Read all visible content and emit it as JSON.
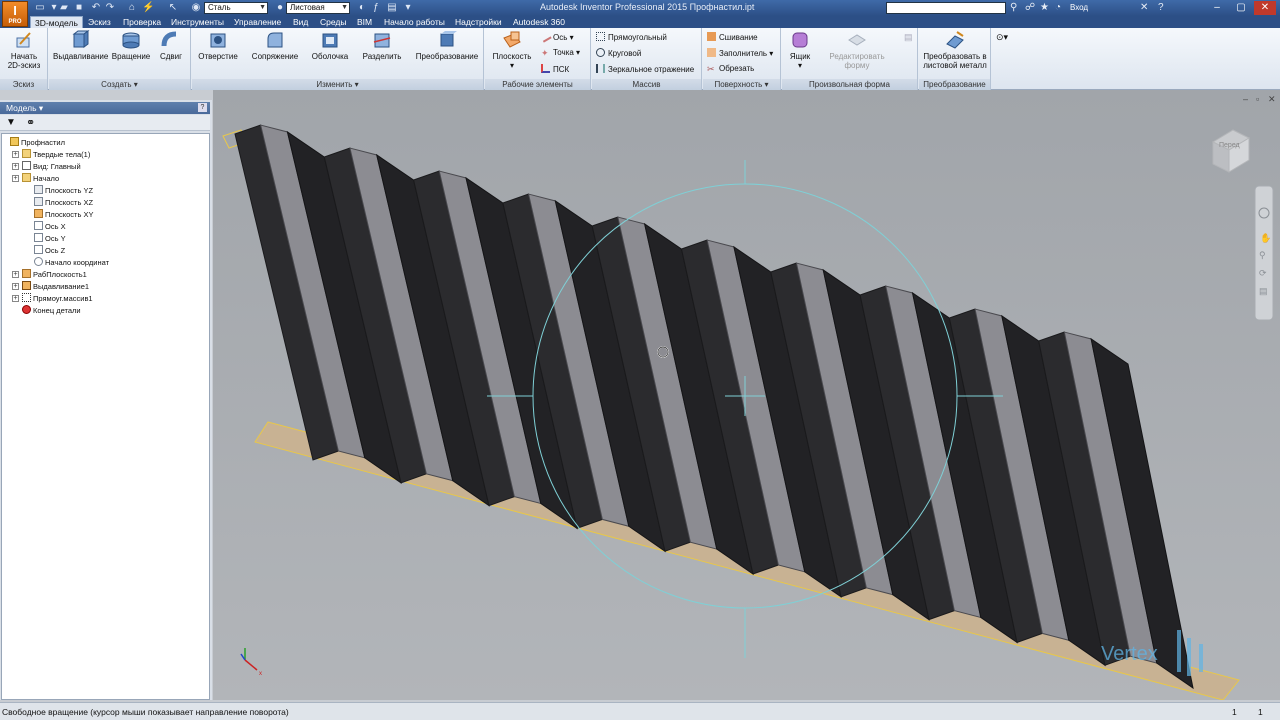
{
  "titlebar": {
    "logo": "I",
    "logo_sub": "PRO",
    "material_combo": "Сталь",
    "style_combo": "Листовая",
    "window_title": "Autodesk Inventor Professional 2015    Профнастил.ipt",
    "search_placeholder": "",
    "signin_label": "Вход"
  },
  "ribbon_tabs": [
    {
      "label": "3D-модель",
      "active": true
    },
    {
      "label": "Эскиз"
    },
    {
      "label": "Проверка"
    },
    {
      "label": "Инструменты"
    },
    {
      "label": "Управление"
    },
    {
      "label": "Вид"
    },
    {
      "label": "Среды"
    },
    {
      "label": "BIM"
    },
    {
      "label": "Начало работы"
    },
    {
      "label": "Надстройки"
    },
    {
      "label": "Autodesk 360"
    }
  ],
  "ribbon": {
    "sketch": {
      "label": "Эскиз",
      "start_line1": "Начать",
      "start_line2": "2D-эскиз"
    },
    "create": {
      "label": "Создать",
      "extrude": "Выдавливание",
      "revolve": "Вращение",
      "sweep": "Сдвиг"
    },
    "modify": {
      "label": "Изменить",
      "hole": "Отверстие",
      "fillet": "Сопряжение",
      "shell": "Оболочка",
      "split": "Разделить",
      "convert": "Преобразование"
    },
    "work": {
      "label": "Рабочие элементы",
      "plane": "Плоскость",
      "axis": "Ось",
      "point": "Точка",
      "ucs": "ПСК"
    },
    "pattern": {
      "label": "Массив",
      "rect": "Прямоугольный",
      "circular": "Круговой",
      "mirror": "Зеркальное отражение"
    },
    "surface": {
      "label": "Поверхность",
      "stitch": "Сшивание",
      "patch": "Заполнитель",
      "trim": "Обрезать"
    },
    "freeform": {
      "label": "Произвольная форма",
      "box": "Ящик",
      "edit_line1": "Редактировать",
      "edit_line2": "форму"
    },
    "convertp": {
      "label": "Преобразование",
      "to_sheet_line1": "Преобразовать в",
      "to_sheet_line2": "листовой металл"
    }
  },
  "browser": {
    "title": "Модель",
    "help": "?",
    "tree": [
      {
        "label": "Профнастил",
        "icon": "part-icon",
        "level": 0
      },
      {
        "label": "Твердые тела(1)",
        "icon": "folder-icon",
        "level": 1,
        "expandable": true
      },
      {
        "label": "Вид: Главный",
        "icon": "view-icon",
        "level": 1,
        "expandable": true
      },
      {
        "label": "Начало",
        "icon": "folder-icon",
        "level": 1,
        "expandable": true
      },
      {
        "label": "Плоскость YZ",
        "icon": "plane-icon",
        "level": 2
      },
      {
        "label": "Плоскость XZ",
        "icon": "plane-icon",
        "level": 2
      },
      {
        "label": "Плоскость XY",
        "icon": "plane-highlight-icon",
        "level": 2
      },
      {
        "label": "Ось X",
        "icon": "axis-icon",
        "level": 2
      },
      {
        "label": "Ось Y",
        "icon": "axis-icon",
        "level": 2
      },
      {
        "label": "Ось Z",
        "icon": "axis-icon",
        "level": 2
      },
      {
        "label": "Начало координат",
        "icon": "origin-icon",
        "level": 2
      },
      {
        "label": "РабПлоскость1",
        "icon": "plane-highlight-icon",
        "level": 1,
        "expandable": true
      },
      {
        "label": "Выдавливание1",
        "icon": "extrude-icon",
        "level": 1,
        "expandable": true
      },
      {
        "label": "Прямоуг.массив1",
        "icon": "pattern-icon",
        "level": 1,
        "expandable": true
      },
      {
        "label": "Конец детали",
        "icon": "end-icon",
        "level": 1
      }
    ]
  },
  "viewport": {
    "viewcube_label": "Перед",
    "watermark": "Vertex"
  },
  "statusbar": {
    "text": "Свободное вращение (курсор мыши показывает направление поворота)",
    "count1": "1",
    "count2": "1"
  }
}
